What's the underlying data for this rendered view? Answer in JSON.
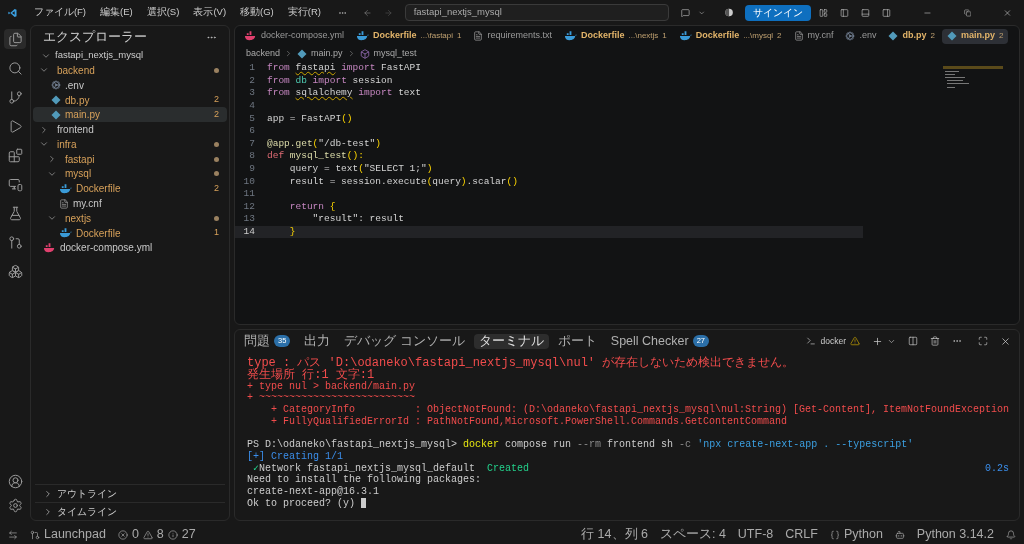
{
  "title_bar": {
    "menus": [
      "ファイル(F)",
      "編集(E)",
      "選択(S)",
      "表示(V)",
      "移動(G)",
      "実行(R)"
    ],
    "search": "fastapi_nextjs_mysql",
    "sign_in": "サインイン"
  },
  "sidebar": {
    "title": "エクスプローラー",
    "tree": {
      "label": "fastapi_nextjs_mysql",
      "expanded": true,
      "children": [
        {
          "label": "backend",
          "kind": "folder",
          "expanded": true,
          "warning": true,
          "dot": true,
          "children": [
            {
              "label": ".env",
              "kind": "gear",
              "warning": false
            },
            {
              "label": "db.py",
              "kind": "python",
              "warning": true,
              "badge": "2"
            },
            {
              "label": "main.py",
              "kind": "python",
              "warning": true,
              "badge": "2",
              "selected": true
            }
          ]
        },
        {
          "label": "frontend",
          "kind": "folder",
          "expanded": false,
          "warning": false
        },
        {
          "label": "infra",
          "kind": "folder",
          "expanded": true,
          "warning": true,
          "dot": true,
          "children": [
            {
              "label": "fastapi",
              "kind": "folder",
              "expanded": false,
              "warning": true,
              "dot": true
            },
            {
              "label": "mysql",
              "kind": "folder",
              "expanded": true,
              "warning": true,
              "dot": true,
              "children": [
                {
                  "label": "Dockerfile",
                  "kind": "docker",
                  "warning": true,
                  "badge": "2"
                },
                {
                  "label": "my.cnf",
                  "kind": "lines",
                  "warning": false
                }
              ]
            },
            {
              "label": "nextjs",
              "kind": "folder",
              "expanded": true,
              "warning": true,
              "dot": true,
              "children": [
                {
                  "label": "Dockerfile",
                  "kind": "docker",
                  "warning": true,
                  "badge": "1"
                }
              ]
            }
          ]
        },
        {
          "label": "docker-compose.yml",
          "kind": "compose",
          "warning": false
        }
      ]
    },
    "sections": [
      {
        "label": "アウトライン",
        "expanded": false
      },
      {
        "label": "タイムライン",
        "expanded": false
      }
    ]
  },
  "tabs": [
    {
      "label": "docker-compose.yml",
      "kind": "compose",
      "warning": false,
      "selected": false
    },
    {
      "label": "Dockerfile",
      "hint": "...\\fastapi",
      "badge": "1",
      "kind": "docker",
      "warning": true,
      "selected": false
    },
    {
      "label": "requirements.txt",
      "kind": "lines",
      "warning": false,
      "selected": false
    },
    {
      "label": "Dockerfile",
      "hint": "...\\nextjs",
      "badge": "1",
      "kind": "docker",
      "warning": true,
      "selected": false
    },
    {
      "label": "Dockerfile",
      "hint": "...\\mysql",
      "badge": "2",
      "kind": "docker",
      "warning": true,
      "selected": false
    },
    {
      "label": "my.cnf",
      "kind": "lines",
      "warning": false,
      "selected": false
    },
    {
      "label": ".env",
      "kind": "gear",
      "warning": false,
      "selected": false
    },
    {
      "label": "db.py",
      "badge": "2",
      "kind": "python",
      "warning": true,
      "selected": false
    },
    {
      "label": "main.py",
      "badge": "2",
      "kind": "python",
      "warning": true,
      "selected": true
    }
  ],
  "breadcrumbs": [
    {
      "label": "backend",
      "kind": "folder"
    },
    {
      "label": "main.py",
      "kind": "python"
    },
    {
      "label": "mysql_test",
      "kind": "symbol"
    }
  ],
  "code": [
    {
      "n": "1",
      "current": false,
      "tokens": [
        {
          "text": "from ",
          "kind": "keyword"
        },
        {
          "text": "fastapi",
          "kind": "plain",
          "warn": true
        },
        {
          "text": " import ",
          "kind": "keyword"
        },
        {
          "text": "FastAPI",
          "kind": "plain"
        }
      ]
    },
    {
      "n": "2",
      "current": false,
      "tokens": [
        {
          "text": "from ",
          "kind": "keyword"
        },
        {
          "text": "db",
          "kind": "module"
        },
        {
          "text": " import ",
          "kind": "keyword"
        },
        {
          "text": "session",
          "kind": "plain"
        }
      ]
    },
    {
      "n": "3",
      "current": false,
      "tokens": [
        {
          "text": "from ",
          "kind": "keyword"
        },
        {
          "text": "sqlalchemy",
          "kind": "plain",
          "warn": true
        },
        {
          "text": " import ",
          "kind": "keyword"
        },
        {
          "text": "text",
          "kind": "plain"
        }
      ]
    },
    {
      "n": "4",
      "current": false
    },
    {
      "n": "5",
      "current": false,
      "tokens": [
        {
          "text": "app = FastAPI",
          "kind": "plain"
        },
        {
          "text": "()",
          "kind": "bracket"
        }
      ]
    },
    {
      "n": "6",
      "current": false
    },
    {
      "n": "7",
      "current": false,
      "tokens": [
        {
          "text": "@app.get",
          "kind": "function"
        },
        {
          "text": "(",
          "kind": "bracket"
        },
        {
          "text": "\"/db-test\"",
          "kind": "plain"
        },
        {
          "text": ")",
          "kind": "bracket"
        }
      ]
    },
    {
      "n": "8",
      "current": false,
      "tokens": [
        {
          "text": "def ",
          "kind": "def"
        },
        {
          "text": "mysql_test",
          "kind": "function"
        },
        {
          "text": "():",
          "kind": "bracket"
        }
      ]
    },
    {
      "n": "9",
      "current": false,
      "tokens": [
        {
          "text": "    query = text",
          "kind": "plain"
        },
        {
          "text": "(",
          "kind": "bracket"
        },
        {
          "text": "\"SELECT 1;\"",
          "kind": "plain"
        },
        {
          "text": ")",
          "kind": "bracket"
        }
      ]
    },
    {
      "n": "10",
      "current": false,
      "tokens": [
        {
          "text": "    result = session.execute",
          "kind": "plain"
        },
        {
          "text": "(",
          "kind": "bracket"
        },
        {
          "text": "query",
          "kind": "plain"
        },
        {
          "text": ")",
          "kind": "bracket"
        },
        {
          "text": ".scalar",
          "kind": "plain"
        },
        {
          "text": "()",
          "kind": "bracket"
        }
      ]
    },
    {
      "n": "11",
      "current": false
    },
    {
      "n": "12",
      "current": false,
      "tokens": [
        {
          "text": "    return ",
          "kind": "keyword"
        },
        {
          "text": "{",
          "kind": "bracket"
        }
      ]
    },
    {
      "n": "13",
      "current": false,
      "tokens": [
        {
          "text": "        \"result\"",
          "kind": "plain"
        },
        {
          "text": ": result",
          "kind": "plain"
        }
      ]
    },
    {
      "n": "14",
      "current": true,
      "tokens": [
        {
          "text": "    }",
          "kind": "bracket"
        }
      ]
    }
  ],
  "panel": {
    "tabs": [
      {
        "label": "問題",
        "badge": "35",
        "selected": false
      },
      {
        "label": "出力",
        "selected": false
      },
      {
        "label": "デバッグ コンソール",
        "selected": false
      },
      {
        "label": "ターミナル",
        "selected": true
      },
      {
        "label": "ポート",
        "selected": false
      },
      {
        "label": "Spell Checker",
        "badge": "27",
        "selected": false
      }
    ],
    "terminal_name": "docker",
    "lines": [
      {
        "segments": [
          {
            "text": "type : パス 'D:\\odaneko\\fastapi_nextjs_mysql\\nul' が存在しないため検出できません。",
            "kind": "error"
          }
        ]
      },
      {
        "segments": [
          {
            "text": "発生場所 行:1 文字:1",
            "kind": "error"
          }
        ]
      },
      {
        "segments": [
          {
            "text": "+ type nul > backend/main.py",
            "kind": "error"
          }
        ]
      },
      {
        "segments": [
          {
            "text": "+ ~~~~~~~~~~~~~~~~~~~~~~~~~~",
            "kind": "error"
          }
        ]
      },
      {
        "segments": [
          {
            "text": "    + CategoryInfo          : ObjectNotFound: (D:\\odaneko\\fastapi_nextjs_mysql\\nul:String) [Get-Content], ItemNotFoundException",
            "kind": "error"
          }
        ]
      },
      {
        "segments": [
          {
            "text": "    + FullyQualifiedErrorId : PathNotFound,Microsoft.PowerShell.Commands.GetContentCommand",
            "kind": "error"
          }
        ]
      },
      {
        "gap_before": true,
        "segments": [
          {
            "text": "PS D:\\odaneko\\fastapi_nextjs_mysql> ",
            "kind": "plain"
          },
          {
            "text": "docker",
            "kind": "command"
          },
          {
            "text": " compose run ",
            "kind": "plain"
          },
          {
            "text": "--rm",
            "kind": "flag"
          },
          {
            "text": " frontend sh ",
            "kind": "plain"
          },
          {
            "text": "-c",
            "kind": "flag"
          },
          {
            "text": " 'npx create-next-app . --typescript'",
            "kind": "string"
          }
        ]
      },
      {
        "segments": [
          {
            "text": "[+] Creating 1/1",
            "kind": "info"
          }
        ]
      },
      {
        "segments": [
          {
            "text": " ✓",
            "kind": "success"
          },
          {
            "text": "Network fastapi_nextjs_mysql_default  ",
            "kind": "plain"
          },
          {
            "text": "Created",
            "kind": "success"
          }
        ],
        "duration": "0.2s"
      },
      {
        "segments": [
          {
            "text": "Need to install the following packages:",
            "kind": "plain"
          }
        ]
      },
      {
        "segments": [
          {
            "text": "create-next-app@16.3.1",
            "kind": "plain"
          }
        ]
      },
      {
        "segments": [
          {
            "text": "Ok to proceed? (y) ",
            "kind": "plain"
          }
        ],
        "cursor": true
      }
    ]
  },
  "status_bar": {
    "launchpad": "Launchpad",
    "errors": "0",
    "warnings": "8",
    "infos": "27",
    "right": [
      {
        "label": "行 14、列 6",
        "kind": "text"
      },
      {
        "label": "スペース: 4",
        "kind": "text"
      },
      {
        "label": "UTF-8",
        "kind": "text"
      },
      {
        "label": "CRLF",
        "kind": "text"
      },
      {
        "label": "Python",
        "kind": "braces"
      },
      {
        "label": "Python 3.14.2",
        "kind": "copilot"
      }
    ]
  }
}
